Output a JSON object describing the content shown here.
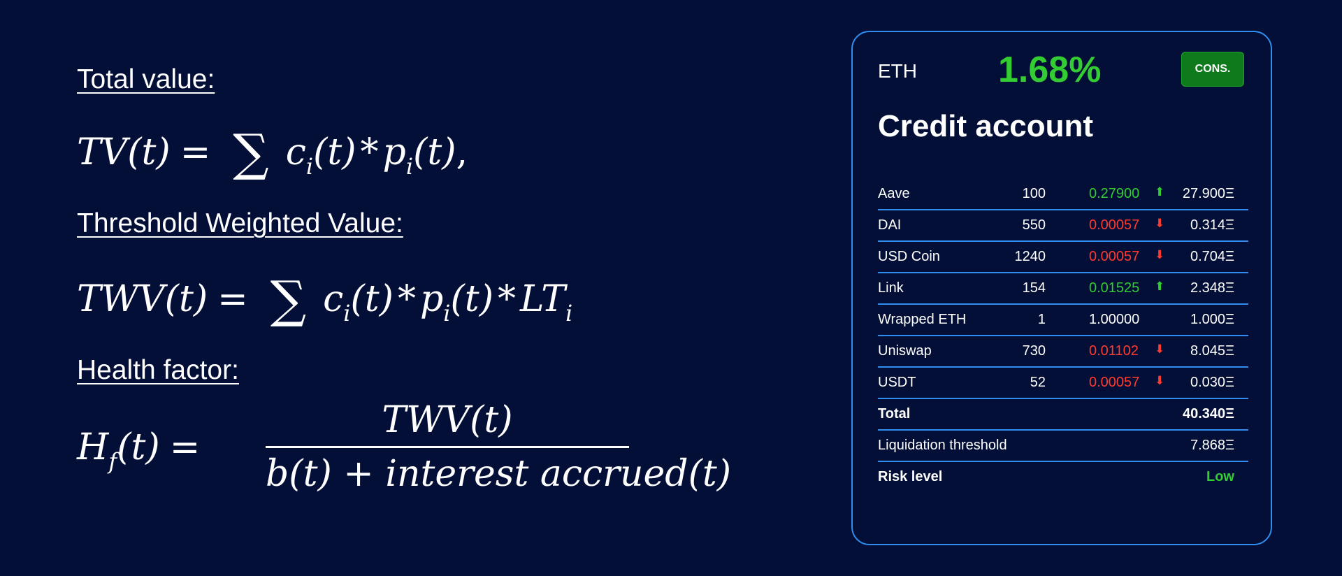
{
  "formulas": {
    "total_value": {
      "heading": "Total value:",
      "lhs": "TV(t)",
      "eq": "=",
      "sum": "∑",
      "c": "c",
      "p": "p",
      "i": "i",
      "arg": "(t)",
      "ast": "*",
      "tail": ","
    },
    "threshold_weighted": {
      "heading": "Threshold Weighted Value:",
      "lhs": "TWV(t)",
      "eq": "=",
      "sum": "∑",
      "c": "c",
      "p": "p",
      "i": "i",
      "arg": "(t)",
      "ast": "*",
      "lt": "LT"
    },
    "health_factor": {
      "heading": "Health factor:",
      "h": "H",
      "f": "f",
      "arg": "(t)",
      "eq": "=",
      "numerator": "TWV(t)",
      "denominator": "b(t) + interest accrued(t)"
    }
  },
  "card": {
    "asset": "ETH",
    "rate": "1.68%",
    "badge": "CONS.",
    "title": "Credit account",
    "rows": [
      {
        "name": "Aave",
        "qty": "100",
        "price": "0.27900",
        "trend": "up",
        "arrow": "⬆",
        "value": "27.900Ξ"
      },
      {
        "name": "DAI",
        "qty": "550",
        "price": "0.00057",
        "trend": "down",
        "arrow": "⬇",
        "value": "0.314Ξ"
      },
      {
        "name": "USD Coin",
        "qty": "1240",
        "price": "0.00057",
        "trend": "down",
        "arrow": "⬇",
        "value": "0.704Ξ"
      },
      {
        "name": "Link",
        "qty": "154",
        "price": "0.01525",
        "trend": "up",
        "arrow": "⬆",
        "value": "2.348Ξ"
      },
      {
        "name": "Wrapped ETH",
        "qty": "1",
        "price": "1.00000",
        "trend": "flat",
        "arrow": "",
        "value": "1.000Ξ"
      },
      {
        "name": "Uniswap",
        "qty": "730",
        "price": "0.01102",
        "trend": "down",
        "arrow": "⬇",
        "value": "8.045Ξ"
      },
      {
        "name": "USDT",
        "qty": "52",
        "price": "0.00057",
        "trend": "down",
        "arrow": "⬇",
        "value": "0.030Ξ"
      }
    ],
    "total_label": "Total",
    "total_value": "40.340Ξ",
    "liquidation_label": "Liquidation threshold",
    "liquidation_value": "7.868Ξ",
    "risk_label": "Risk level",
    "risk_value": "Low",
    "colors": {
      "up": "#33cc33",
      "down": "#ff3b30",
      "flat": "#ffffff",
      "accent": "#2f8ef0",
      "badge": "#0f7a1c",
      "background": "#030f36"
    }
  }
}
